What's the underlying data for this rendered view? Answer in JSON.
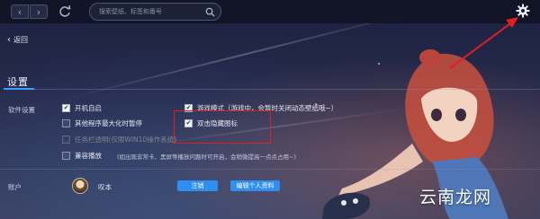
{
  "topbar": {
    "search_placeholder": "搜索壁纸、标签和番号"
  },
  "back": {
    "label": "返回"
  },
  "settings": {
    "title": "设置",
    "software_label": "软件设置",
    "options": {
      "autostart": {
        "label": "开机自启",
        "checked": true
      },
      "pause_on_maximize": {
        "label": "其他程序最大化时暂停",
        "checked": false
      },
      "taskbar_transparent": {
        "label": "任务栏透明(仅限WIN10操作系统)",
        "checked": true,
        "disabled": true
      },
      "compat_playback": {
        "label": "兼容播放",
        "checked": false,
        "note": "(如出现非常卡、黑屏等播放问题时可开启，会稍微提高一点点占用~)"
      },
      "game_mode": {
        "label": "游戏模式（游戏中，会暂时关闭动态壁纸哦~）",
        "checked": true
      },
      "double_click_hide": {
        "label": "双击隐藏图标",
        "checked": true
      }
    }
  },
  "account": {
    "label": "账户",
    "username": "叹本",
    "logout_label": "注销",
    "edit_profile_label": "编辑个人资料"
  },
  "watermark": "云南龙网",
  "colors": {
    "accent": "#2f8ff0",
    "highlight_box": "#e02020",
    "annotation_arrow": "#e02020"
  }
}
